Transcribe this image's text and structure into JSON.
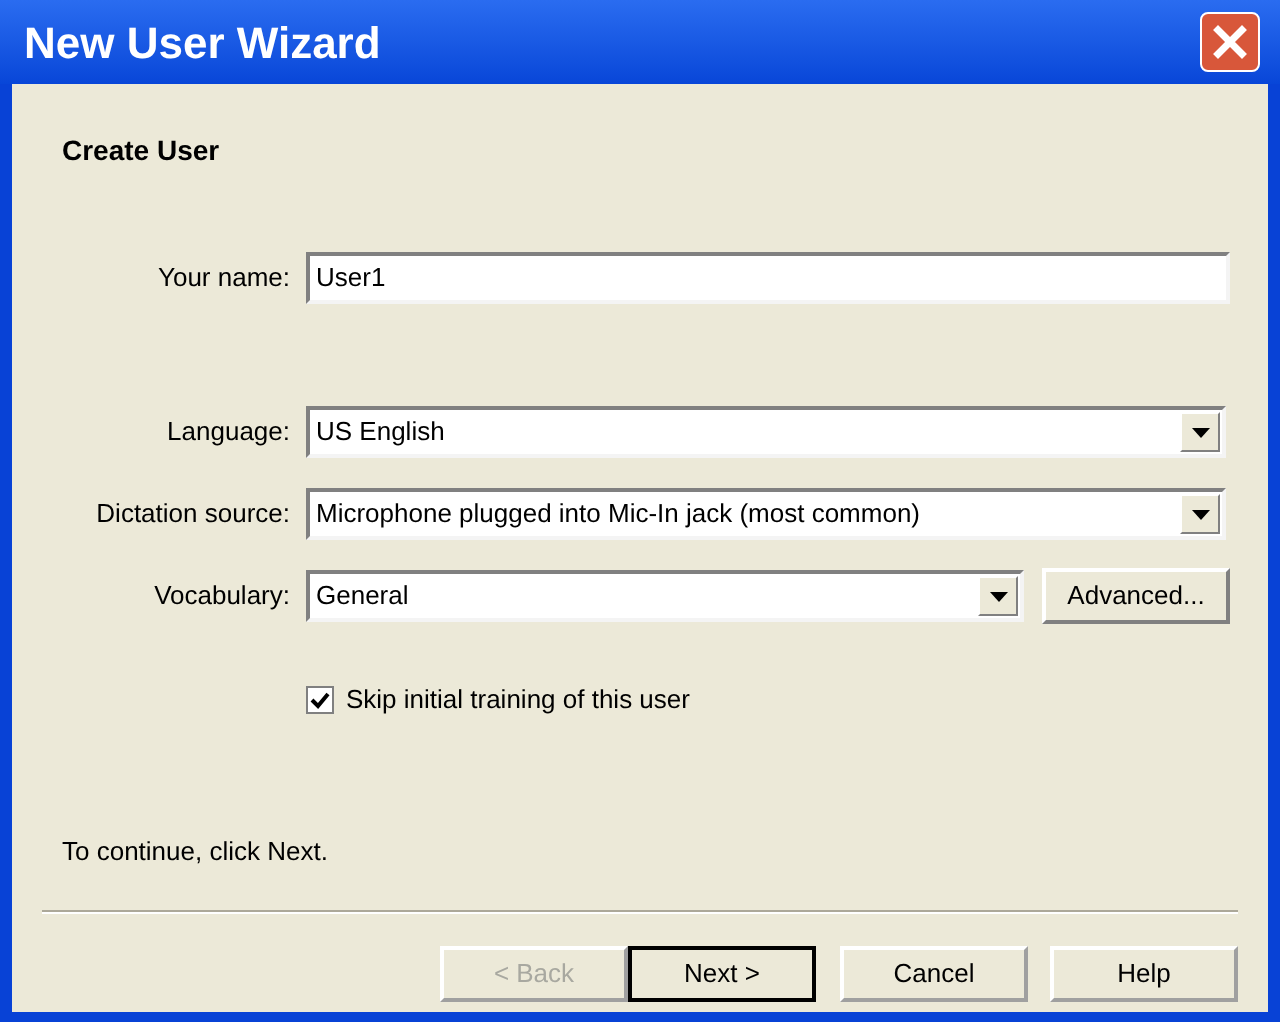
{
  "window": {
    "title": "New User Wizard"
  },
  "heading": "Create User",
  "fields": [
    {
      "kind": "text",
      "label": "Your name:",
      "value": "User1"
    },
    {
      "kind": "dropdown",
      "label": "Language:",
      "value": "US English"
    },
    {
      "kind": "dropdown",
      "label": "Dictation source:",
      "value": "Microphone plugged into Mic-In jack (most common)"
    },
    {
      "kind": "dropdown",
      "label": "Vocabulary:",
      "value": "General",
      "button": "Advanced..."
    }
  ],
  "checkbox": {
    "label": "Skip initial training of this user",
    "checked": true
  },
  "instruction": "To continue, click Next.",
  "buttons": [
    {
      "label": "< Back",
      "disabled": true,
      "default": false
    },
    {
      "label": "Next >",
      "disabled": false,
      "default": true
    },
    {
      "label": "Cancel",
      "disabled": false,
      "default": false
    },
    {
      "label": "Help",
      "disabled": false,
      "default": false
    }
  ]
}
